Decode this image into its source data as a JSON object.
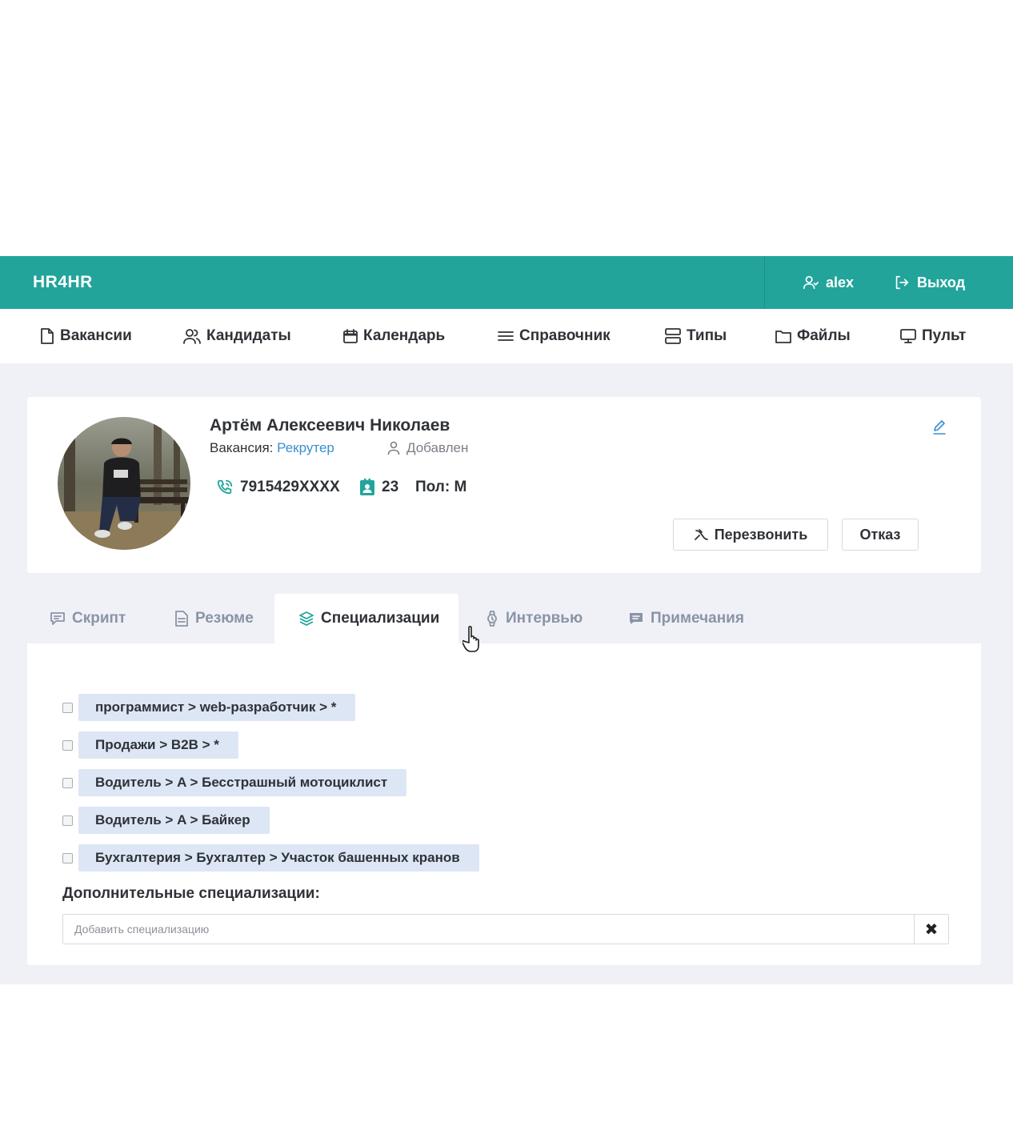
{
  "app": {
    "brand": "HR4HR",
    "user_name": "alex",
    "logout_label": "Выход"
  },
  "nav": {
    "items": [
      {
        "label": "Вакансии",
        "icon": "document-icon"
      },
      {
        "label": "Кандидаты",
        "icon": "users-icon"
      },
      {
        "label": "Календарь",
        "icon": "calendar-icon"
      },
      {
        "label": "Справочник",
        "icon": "list-icon"
      },
      {
        "label": "Типы",
        "icon": "server-icon"
      },
      {
        "label": "Файлы",
        "icon": "folder-icon"
      },
      {
        "label": "Пульт",
        "icon": "monitor-icon"
      }
    ]
  },
  "candidate": {
    "name": "Артём Алексеевич Николаев",
    "vacancy_label": "Вакансия:",
    "vacancy_value": "Рекрутер",
    "status": "Добавлен",
    "phone": "7915429XXXX",
    "age": "23",
    "gender": "Пол: М",
    "callback_label": "Перезвонить",
    "reject_label": "Отказ"
  },
  "tabs": [
    {
      "label": "Скрипт",
      "active": false
    },
    {
      "label": "Резюме",
      "active": false
    },
    {
      "label": "Специализации",
      "active": true
    },
    {
      "label": "Интервью",
      "active": false
    },
    {
      "label": "Примечания",
      "active": false
    }
  ],
  "specializations": {
    "items": [
      {
        "label": "программист > web-разработчик > *",
        "checked": false
      },
      {
        "label": "Продажи > B2B > *",
        "checked": false
      },
      {
        "label": "Водитель > A > Бесстрашный мотоциклист",
        "checked": false
      },
      {
        "label": "Водитель > A > Байкер",
        "checked": false
      },
      {
        "label": "Бухгалтерия > Бухгалтер > Участок башенных кранов",
        "checked": false
      }
    ],
    "extra_label": "Дополнительные специализации:",
    "extra_placeholder": "Добавить специализацию",
    "extra_value": "",
    "clear_glyph": "✖"
  },
  "colors": {
    "brand": "#22a49b",
    "link": "#3a8fd0",
    "chip": "#dde6f5",
    "content_bg": "#f0f1f7"
  }
}
